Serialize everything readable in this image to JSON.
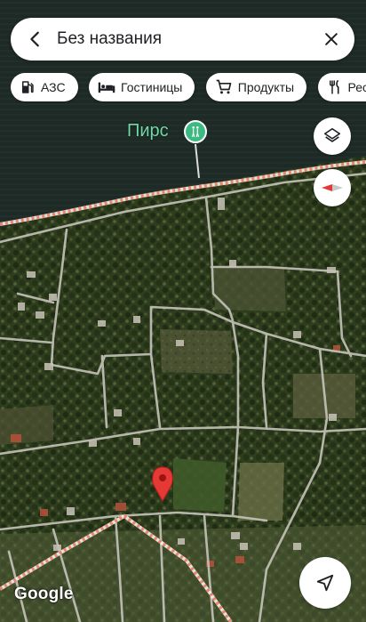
{
  "search": {
    "title": "Без названия"
  },
  "chips": [
    {
      "label": "АЗС",
      "icon": "gas-station-icon"
    },
    {
      "label": "Гостиницы",
      "icon": "bed-icon"
    },
    {
      "label": "Продукты",
      "icon": "shopping-cart-icon"
    },
    {
      "label": "Рес",
      "icon": "restaurant-icon"
    }
  ],
  "map": {
    "poi_label": "Пирс",
    "poi_icon": "pier-icon",
    "attribution": "Google",
    "marker_icon": "red-pin-icon",
    "colors": {
      "water": "#1f2b26",
      "boundary": "#e8856a",
      "roads": "#c9c9c9",
      "pin": "#e53935",
      "poi": "#3cba82"
    }
  },
  "buttons": {
    "layers_icon": "layers-icon",
    "compass_icon": "compass-icon",
    "location_icon": "my-location-arrow-icon"
  }
}
